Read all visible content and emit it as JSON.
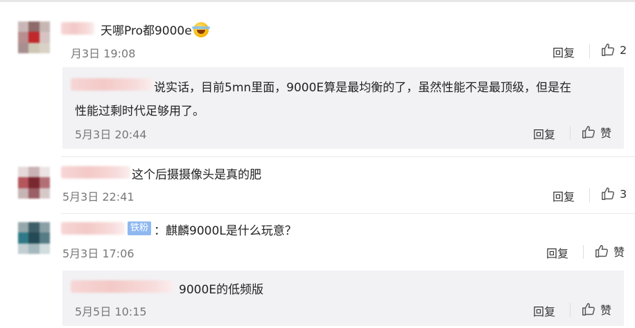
{
  "comments": [
    {
      "text": "天哪Pro都9000e",
      "time": "月3日 19:08",
      "reply_label": "回复",
      "like_count": "2",
      "avatar_colors": [
        "#c9b7b7",
        "#8e6a6a",
        "#c7b6b4",
        "#b88f8f",
        "#c0282c",
        "#d6c3c2",
        "#a78f90",
        "#cfc7b5",
        "#d9d2c6"
      ]
    },
    {
      "text": "这个后摄摄像头是真的肥",
      "time": "5月3日 22:41",
      "reply_label": "回复",
      "like_count": "3",
      "avatar_colors": [
        "#e5dada",
        "#c9b3b4",
        "#ece4e4",
        "#b4565c",
        "#7a2830",
        "#b27076",
        "#c7b4b4",
        "#9a6066",
        "#d8c9c9"
      ]
    },
    {
      "badge": "铁粉",
      "text": "：麒麟9000L是什么玩意？",
      "time": "5月3日 17:06",
      "reply_label": "回复",
      "like_label": "赞",
      "avatar_colors": [
        "#96a7ab",
        "#3e5f67",
        "#8aa0a5",
        "#2f7a86",
        "#244b55",
        "#567c86",
        "#c1cfd2",
        "#a4b8bd",
        "#d1dcde"
      ]
    }
  ],
  "replies": [
    {
      "text_line1": "说实话，目前5mn里面，9000E算是最均衡的了，虽然性能不是最顶级，但是在",
      "text_line2": "性能过剩时代足够用了。",
      "time": "5月3日 20:44",
      "reply_label": "回复",
      "like_label": "赞"
    },
    {
      "text": "9000E的低频版",
      "time": "5月5日 10:15",
      "reply_label": "回复",
      "like_label": "赞"
    }
  ]
}
